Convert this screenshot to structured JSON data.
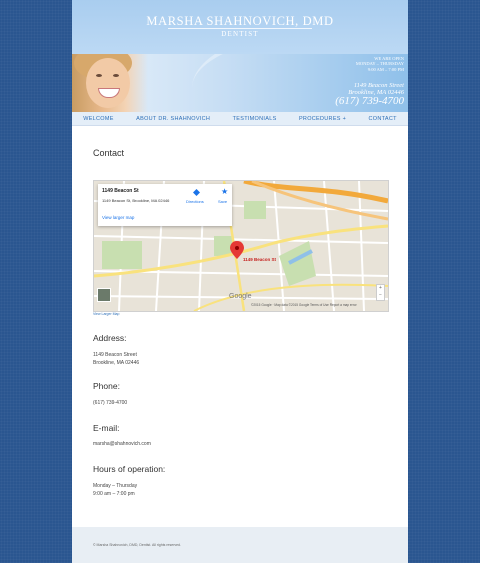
{
  "site": {
    "name": "MARSHA SHAHNOVICH, DMD",
    "subtitle": "DENTIST"
  },
  "banner": {
    "hours_line1": "WE ARE OPEN",
    "hours_line2": "MONDAY – THURSDAY",
    "hours_line3": "9:00 AM – 7:00 PM",
    "address_line1": "1149 Beacon Street",
    "address_line2": "Brookline, MA 02446",
    "phone": "(617) 739-4700"
  },
  "nav": {
    "items": [
      "WELCOME",
      "ABOUT DR. SHAHNOVICH",
      "TESTIMONIALS",
      "PROCEDURES +",
      "CONTACT"
    ]
  },
  "content": {
    "title": "Contact"
  },
  "map": {
    "card_title": "1149 Beacon St",
    "card_address": "1149 Beacon St, Brookline, MA 02446",
    "card_link": "View larger map",
    "directions": "Directions",
    "save": "Save",
    "pin_label": "1149 Beacon St",
    "google": "Google",
    "attribution": "©2015 Google · Map data ©2015 Google   Terms of Use   Report a map error",
    "zoom_in": "+",
    "zoom_out": "−",
    "below_link": "View Larger Map"
  },
  "sections": {
    "address_heading": "Address:",
    "address_line1": "1149 Beacon Street",
    "address_line2": "Brookline, MA 02446",
    "phone_heading": "Phone:",
    "phone_value": "(617) 739-4700",
    "email_heading": "E-mail:",
    "email_value": "marsha@shahnovich.com",
    "hours_heading": "Hours of operation:",
    "hours_line1": "Monday – Thursday",
    "hours_line2": "9:00 am – 7:00 pm"
  },
  "footer": {
    "copyright": "© Marsha Shahnovich, DMD, Dentist. All rights reserved."
  },
  "colors": {
    "background": "#2a5690",
    "header": "#a9cdef",
    "nav_text": "#2d6fb7"
  }
}
